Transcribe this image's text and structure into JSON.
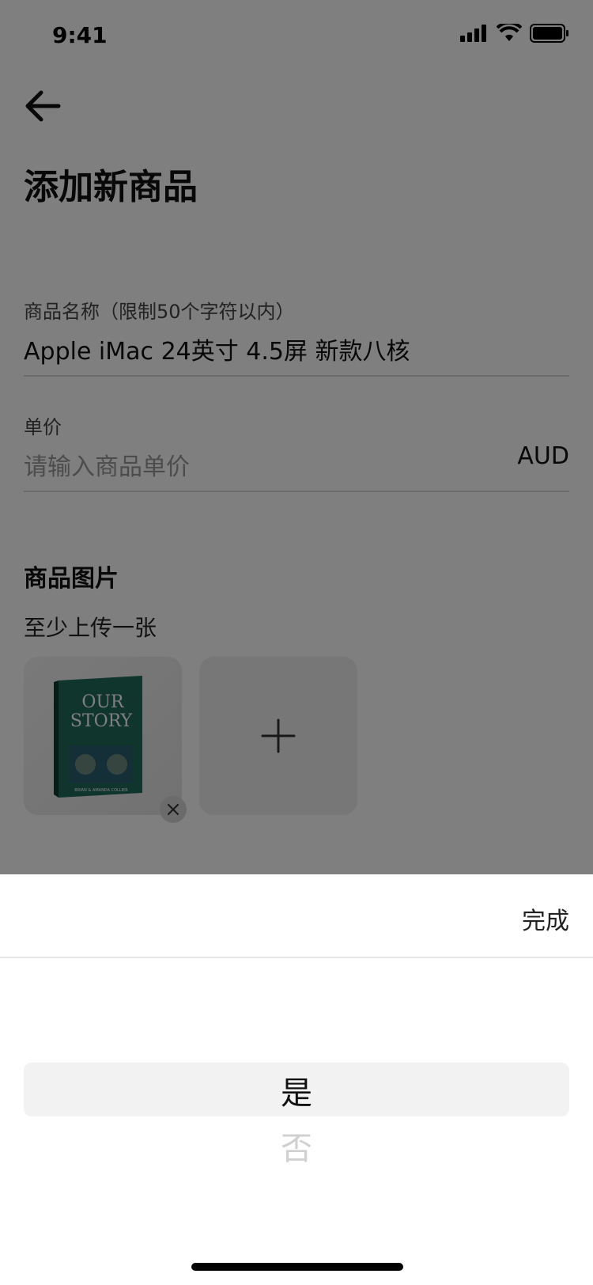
{
  "status_bar": {
    "time": "9:41"
  },
  "header": {
    "title": "添加新商品"
  },
  "form": {
    "name": {
      "label": "商品名称（限制50个字符以内）",
      "value": "Apple iMac 24英寸 4.5屏 新款八核"
    },
    "price": {
      "label": "单价",
      "placeholder": "请输入商品单价",
      "currency": "AUD"
    }
  },
  "images": {
    "title": "商品图片",
    "subtitle": "至少上传一张",
    "thumbnail": {
      "title_line1": "OUR",
      "title_line2": "STORY",
      "authors": "BRIAN & AMANDA COLLIER"
    }
  },
  "picker": {
    "done_label": "完成",
    "options": [
      "是",
      "否"
    ],
    "selected": "是"
  },
  "colors": {
    "overlay": "rgba(0,0,0,0.5)",
    "book_cover": "#1f6a5a"
  }
}
